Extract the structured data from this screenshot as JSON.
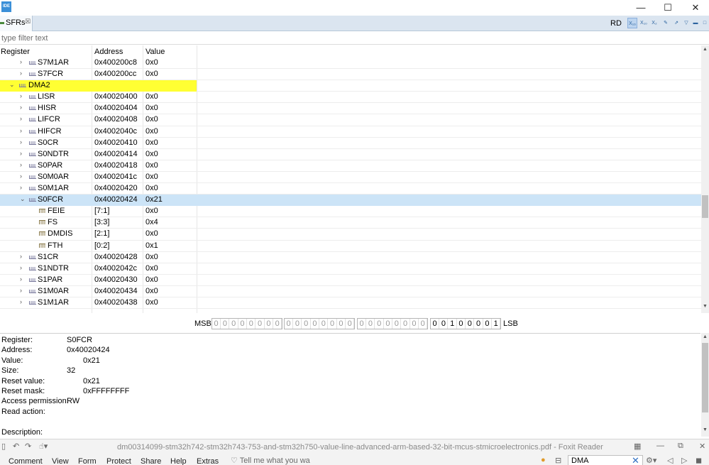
{
  "window": {
    "app_icon_text": "IDE",
    "minimize_glyph": "—",
    "maximize_glyph": "☐",
    "close_glyph": "✕"
  },
  "view": {
    "tab_label": "SFRs",
    "tab_close_glyph": "☒",
    "mode_label": "RD",
    "toolbar_icons": [
      "hex-format-icon",
      "decimal-format-icon",
      "binary-format-icon",
      "pin-icon",
      "export-icon",
      "view-menu-icon",
      "minimize-view-icon",
      "maximize-view-icon"
    ]
  },
  "filter": {
    "placeholder": "type filter text",
    "value": ""
  },
  "table": {
    "columns": [
      "Register",
      "Address",
      "Value"
    ],
    "rows": [
      {
        "name": "S7M1AR",
        "address": "0x400200c8",
        "value": "0x0",
        "level": 1,
        "kind": "register",
        "expanded": false
      },
      {
        "name": "S7FCR",
        "address": "0x400200cc",
        "value": "0x0",
        "level": 1,
        "kind": "register",
        "expanded": false
      },
      {
        "name": "DMA2",
        "address": "",
        "value": "",
        "level": 0,
        "kind": "group",
        "expanded": true
      },
      {
        "name": "LISR",
        "address": "0x40020400",
        "value": "0x0",
        "level": 1,
        "kind": "register",
        "expanded": false
      },
      {
        "name": "HISR",
        "address": "0x40020404",
        "value": "0x0",
        "level": 1,
        "kind": "register",
        "expanded": false
      },
      {
        "name": "LIFCR",
        "address": "0x40020408",
        "value": "0x0",
        "level": 1,
        "kind": "register",
        "expanded": false
      },
      {
        "name": "HIFCR",
        "address": "0x4002040c",
        "value": "0x0",
        "level": 1,
        "kind": "register",
        "expanded": false
      },
      {
        "name": "S0CR",
        "address": "0x40020410",
        "value": "0x0",
        "level": 1,
        "kind": "register",
        "expanded": false
      },
      {
        "name": "S0NDTR",
        "address": "0x40020414",
        "value": "0x0",
        "level": 1,
        "kind": "register",
        "expanded": false
      },
      {
        "name": "S0PAR",
        "address": "0x40020418",
        "value": "0x0",
        "level": 1,
        "kind": "register",
        "expanded": false
      },
      {
        "name": "S0M0AR",
        "address": "0x4002041c",
        "value": "0x0",
        "level": 1,
        "kind": "register",
        "expanded": false
      },
      {
        "name": "S0M1AR",
        "address": "0x40020420",
        "value": "0x0",
        "level": 1,
        "kind": "register",
        "expanded": false
      },
      {
        "name": "S0FCR",
        "address": "0x40020424",
        "value": "0x21",
        "level": 1,
        "kind": "register",
        "expanded": true,
        "selected": true
      },
      {
        "name": "FEIE",
        "address": "[7:1]",
        "value": "0x0",
        "level": 2,
        "kind": "field"
      },
      {
        "name": "FS",
        "address": "[3:3]",
        "value": "0x4",
        "level": 2,
        "kind": "field"
      },
      {
        "name": "DMDIS",
        "address": "[2:1]",
        "value": "0x0",
        "level": 2,
        "kind": "field"
      },
      {
        "name": "FTH",
        "address": "[0:2]",
        "value": "0x1",
        "level": 2,
        "kind": "field"
      },
      {
        "name": "S1CR",
        "address": "0x40020428",
        "value": "0x0",
        "level": 1,
        "kind": "register",
        "expanded": false
      },
      {
        "name": "S1NDTR",
        "address": "0x4002042c",
        "value": "0x0",
        "level": 1,
        "kind": "register",
        "expanded": false
      },
      {
        "name": "S1PAR",
        "address": "0x40020430",
        "value": "0x0",
        "level": 1,
        "kind": "register",
        "expanded": false
      },
      {
        "name": "S1M0AR",
        "address": "0x40020434",
        "value": "0x0",
        "level": 1,
        "kind": "register",
        "expanded": false
      },
      {
        "name": "S1M1AR",
        "address": "0x40020438",
        "value": "0x0",
        "level": 1,
        "kind": "register",
        "expanded": false
      }
    ]
  },
  "bits": {
    "msb_label": "MSB",
    "lsb_label": "LSB",
    "values": "00000000000000000000000000100001",
    "highlighted": [
      24,
      25,
      26,
      27,
      28,
      29,
      30,
      31
    ]
  },
  "details": [
    {
      "label": "Register:",
      "value": "S0FCR",
      "indent": "narrow"
    },
    {
      "label": "Address:",
      "value": "0x40020424",
      "indent": "narrow"
    },
    {
      "label": "Value:",
      "value": "0x21",
      "indent": "wide"
    },
    {
      "label": "Size:",
      "value": "32",
      "indent": "narrow"
    },
    {
      "label": "Reset value:",
      "value": "0x21",
      "indent": "wide"
    },
    {
      "label": "Reset mask:",
      "value": "0xFFFFFFFF",
      "indent": "wide"
    },
    {
      "label": "Access permission:",
      "value": "RW",
      "indent": "narrow"
    },
    {
      "label": "Read action:",
      "value": "",
      "indent": "narrow"
    },
    {
      "label": "",
      "value": "",
      "indent": "narrow"
    },
    {
      "label": "Description:",
      "value": "",
      "indent": "narrow"
    }
  ],
  "foxit": {
    "title": "dm00314099-stm32h742-stm32h743-753-and-stm32h750-value-line-advanced-arm-based-32-bit-mcus-stmicroelectronics.pdf - Foxit Reader",
    "menus": [
      "Comment",
      "View",
      "Form",
      "Protect",
      "Share",
      "Help",
      "Extras"
    ],
    "tell_me": "Tell me what you wa",
    "search_value": "DMA"
  },
  "colors": {
    "group_highlight": "#ffff33",
    "selection": "#cce4f7",
    "tab_bar": "#dbe5f0"
  }
}
